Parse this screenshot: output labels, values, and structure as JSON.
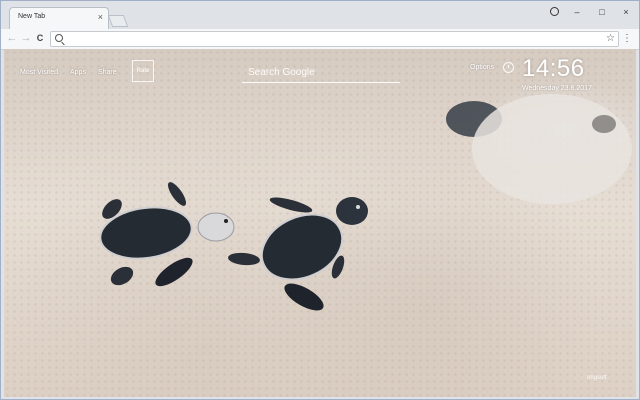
{
  "browser": {
    "tab": {
      "title": "New Tab",
      "close_glyph": "×"
    },
    "window_controls": {
      "minimize": "–",
      "maximize": "□",
      "close": "×"
    },
    "toolbar": {
      "back_glyph": "←",
      "forward_glyph": "→",
      "reload_glyph": "C",
      "omnibox_value": "",
      "star_glyph": "☆",
      "menu_glyph": "⋮"
    }
  },
  "page": {
    "nav": {
      "most_visited": "Most Visited",
      "apps": "Apps",
      "share": "Share"
    },
    "rate_label": "Rate",
    "search_placeholder": "Search Google",
    "options_label": "Options",
    "time": "14:56",
    "date": "Wednesday  23.8.2017",
    "credit": "Imgsoft",
    "wallpaper": {
      "subject": "baby sea turtles on sand"
    }
  },
  "icons": [
    "profile-icon",
    "back-icon",
    "forward-icon",
    "reload-icon",
    "search-icon",
    "star-icon",
    "menu-icon",
    "clock-icon"
  ]
}
